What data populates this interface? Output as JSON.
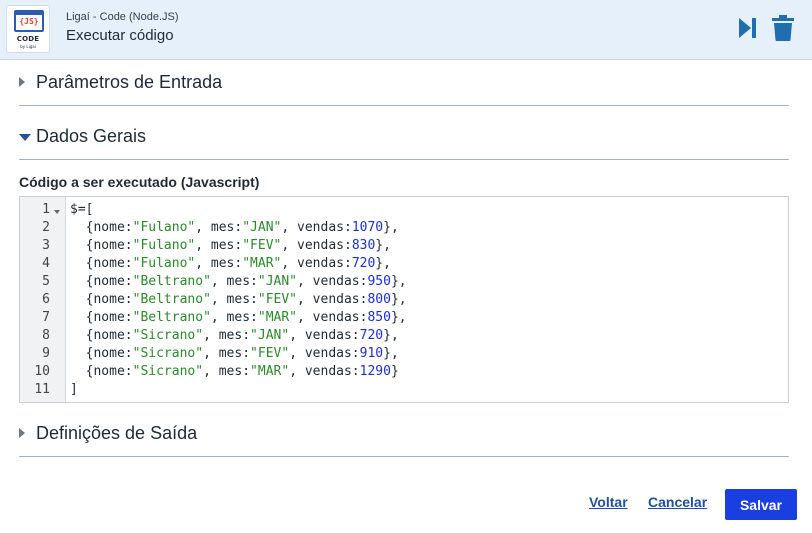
{
  "header": {
    "app_icon": {
      "glyph": "{JS}",
      "code_text": "CODE",
      "by_text": "by Ligaí"
    },
    "subtitle": "Ligaí - Code (Node.JS)",
    "title": "Executar código",
    "run_icon": "run-step-icon",
    "delete_icon": "trash-icon",
    "accent_color": "#1f6fb0"
  },
  "sections": {
    "params": {
      "label": "Parâmetros de Entrada",
      "expanded": false
    },
    "dados": {
      "label": "Dados Gerais",
      "expanded": true
    },
    "saida": {
      "label": "Definições de Saída",
      "expanded": false
    }
  },
  "editor": {
    "label": "Código a ser executado (Javascript)",
    "lines": [
      "$=[",
      "  {nome:\"Fulano\", mes:\"JAN\", vendas:1070},",
      "  {nome:\"Fulano\", mes:\"FEV\", vendas:830},",
      "  {nome:\"Fulano\", mes:\"MAR\", vendas:720},",
      "  {nome:\"Beltrano\", mes:\"JAN\", vendas:950},",
      "  {nome:\"Beltrano\", mes:\"FEV\", vendas:800},",
      "  {nome:\"Beltrano\", mes:\"MAR\", vendas:850},",
      "  {nome:\"Sicrano\", mes:\"JAN\", vendas:720},",
      "  {nome:\"Sicrano\", mes:\"FEV\", vendas:910},",
      "  {nome:\"Sicrano\", mes:\"MAR\", vendas:1290}",
      "]"
    ],
    "colors": {
      "string": "#2a8a2a",
      "number": "#1b2fd6"
    }
  },
  "footer": {
    "back_label": "Voltar",
    "cancel_label": "Cancelar",
    "save_label": "Salvar",
    "save_color": "#1a3fe0"
  }
}
